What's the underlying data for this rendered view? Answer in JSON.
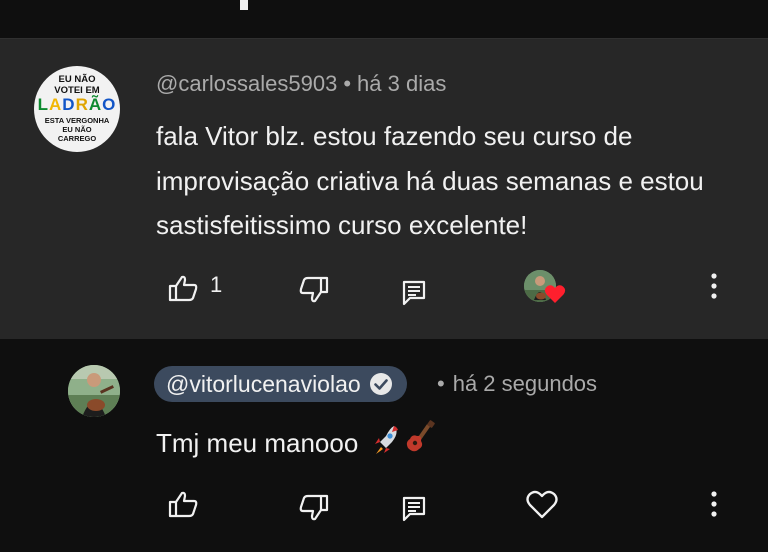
{
  "comment": {
    "author": "@carlossales5903",
    "age": "há 3 dias",
    "text": "fala Vitor blz. estou fazendo seu curso de improvisação criativa  há  duas semanas e estou sastisfeitissimo   curso excelente!",
    "likes": "1",
    "avatar_badge": {
      "line1": "EU NÃO",
      "line2": "VOTEI EM",
      "line3": "LADRÃO",
      "line4": "ESTA VERGONHA",
      "line5": "EU NÃO",
      "line6": "CARREGO"
    },
    "creator_heart": true
  },
  "reply": {
    "author": "@vitorlucenaviolao",
    "verified": true,
    "age": "há 2 segundos",
    "text": "Tmj meu manooo",
    "emoji": [
      "rocket",
      "guitar"
    ]
  },
  "separator": "•",
  "icons": {
    "like": "thumb-up-icon",
    "dislike": "thumb-down-icon",
    "reply": "comment-icon",
    "heart": "heart-icon",
    "more": "more-vert-icon"
  },
  "colors": {
    "background": "#0f0f0f",
    "comment_highlight": "#272727",
    "secondary_text": "#aaaaaa",
    "creator_chip": "#3c4a5e",
    "heart_red": "#ff1f2d"
  }
}
